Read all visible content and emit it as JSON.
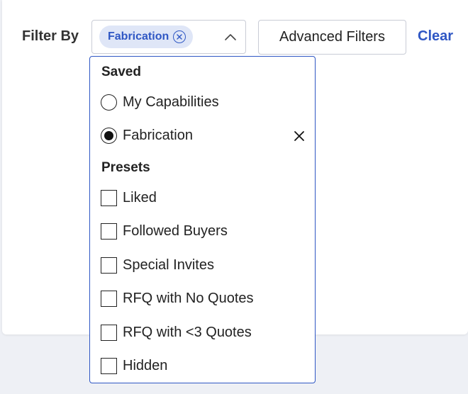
{
  "filter": {
    "label": "Filter By",
    "selected_chip": "Fabrication"
  },
  "toolbar": {
    "advanced_filters_label": "Advanced Filters",
    "clear_label": "Clear"
  },
  "dropdown": {
    "saved_title": "Saved",
    "saved_items": [
      {
        "label": "My Capabilities",
        "selected": false
      },
      {
        "label": "Fabrication",
        "selected": true
      }
    ],
    "presets_title": "Presets",
    "preset_items": [
      {
        "label": "Liked",
        "checked": false
      },
      {
        "label": "Followed Buyers",
        "checked": false
      },
      {
        "label": "Special Invites",
        "checked": false
      },
      {
        "label": "RFQ with No Quotes",
        "checked": false
      },
      {
        "label": "RFQ with <3 Quotes",
        "checked": false
      },
      {
        "label": "Hidden",
        "checked": false
      }
    ]
  },
  "icons": {
    "chip_close": "close-circle-icon",
    "chevron": "chevron-up-icon",
    "remove_saved": "close-icon"
  },
  "colors": {
    "accent": "#2f57c4",
    "chip_background": "#dfe6f7",
    "page_background": "#eef0f5",
    "border": "#c9ccd6"
  }
}
